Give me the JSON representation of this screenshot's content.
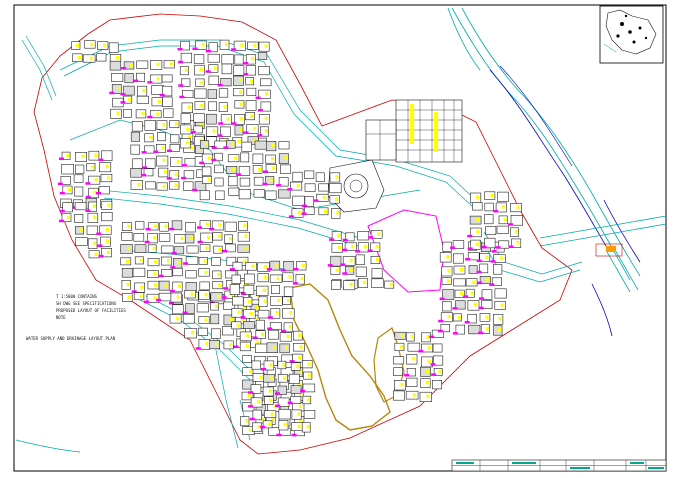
{
  "drawing": {
    "background": "#ffffff",
    "frame_color": "#000000",
    "site_boundary_color": "#cc0000",
    "road_color": "#00aaaa",
    "river_color": "#0000cc",
    "pipe_color": "#ff00ff",
    "unit_tag_color": "#ffff00",
    "lake_edge_color": "#b8860b",
    "annotations": [
      "T 1:5000 CONTAINS",
      "SH DWG SEE SPECIFICATIONS",
      "PROPOSED LAYOUT OF FACILITIES",
      "NOTE",
      "WATER SUPPLY AND DRAINAGE LAYOUT PLAN"
    ],
    "title_block": {
      "cells": [
        "",
        "",
        "",
        "",
        "",
        "",
        "",
        ""
      ]
    }
  }
}
